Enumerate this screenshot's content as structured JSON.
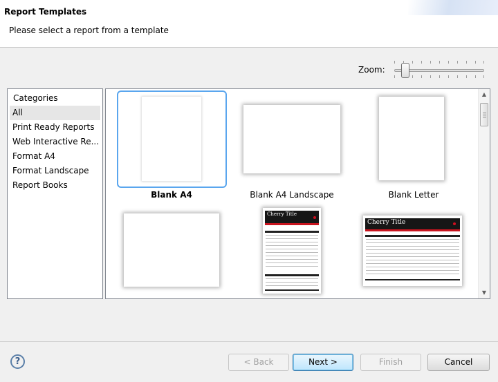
{
  "header": {
    "title": "Report Templates",
    "subtitle": "Please select a report from a template"
  },
  "zoom": {
    "label": "Zoom:",
    "level": 0.1
  },
  "categories": {
    "header": "Categories",
    "items": [
      {
        "label": "All",
        "selected": true
      },
      {
        "label": "Print Ready Reports"
      },
      {
        "label": "Web Interactive Re..."
      },
      {
        "label": "Format A4"
      },
      {
        "label": "Format Landscape"
      },
      {
        "label": "Report Books"
      }
    ]
  },
  "templates": [
    {
      "label": "Blank A4",
      "selected": true
    },
    {
      "label": "Blank A4 Landscape"
    },
    {
      "label": "Blank Letter"
    },
    {
      "label": ""
    },
    {
      "label": "",
      "thumb_title": "Cherry Title"
    },
    {
      "label": "",
      "thumb_title": "Cherry Title"
    }
  ],
  "buttons": {
    "help": "?",
    "back": "< Back",
    "next": "Next >",
    "finish": "Finish",
    "cancel": "Cancel"
  },
  "colors": {
    "selection_frame": "#5aa6ee",
    "cherry_red": "#c8141e",
    "cherry_header": "#161616"
  }
}
